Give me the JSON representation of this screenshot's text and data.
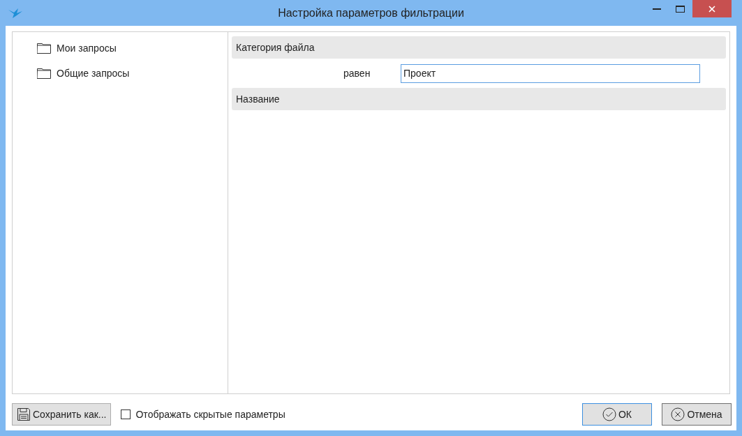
{
  "window": {
    "title": "Настройка параметров фильтрации"
  },
  "tree": [
    {
      "label": "Мои запросы"
    },
    {
      "label": "Общие запросы"
    }
  ],
  "filters": [
    {
      "title": "Категория файла",
      "condition": {
        "operator": "равен",
        "value": "Проект"
      }
    },
    {
      "title": "Название"
    }
  ],
  "footer": {
    "save_button": "Сохранить как...",
    "show_hidden": {
      "label": "Отображать скрытые параметры",
      "checked": false
    },
    "ok_button": "ОК",
    "cancel_button": "Отмена"
  }
}
